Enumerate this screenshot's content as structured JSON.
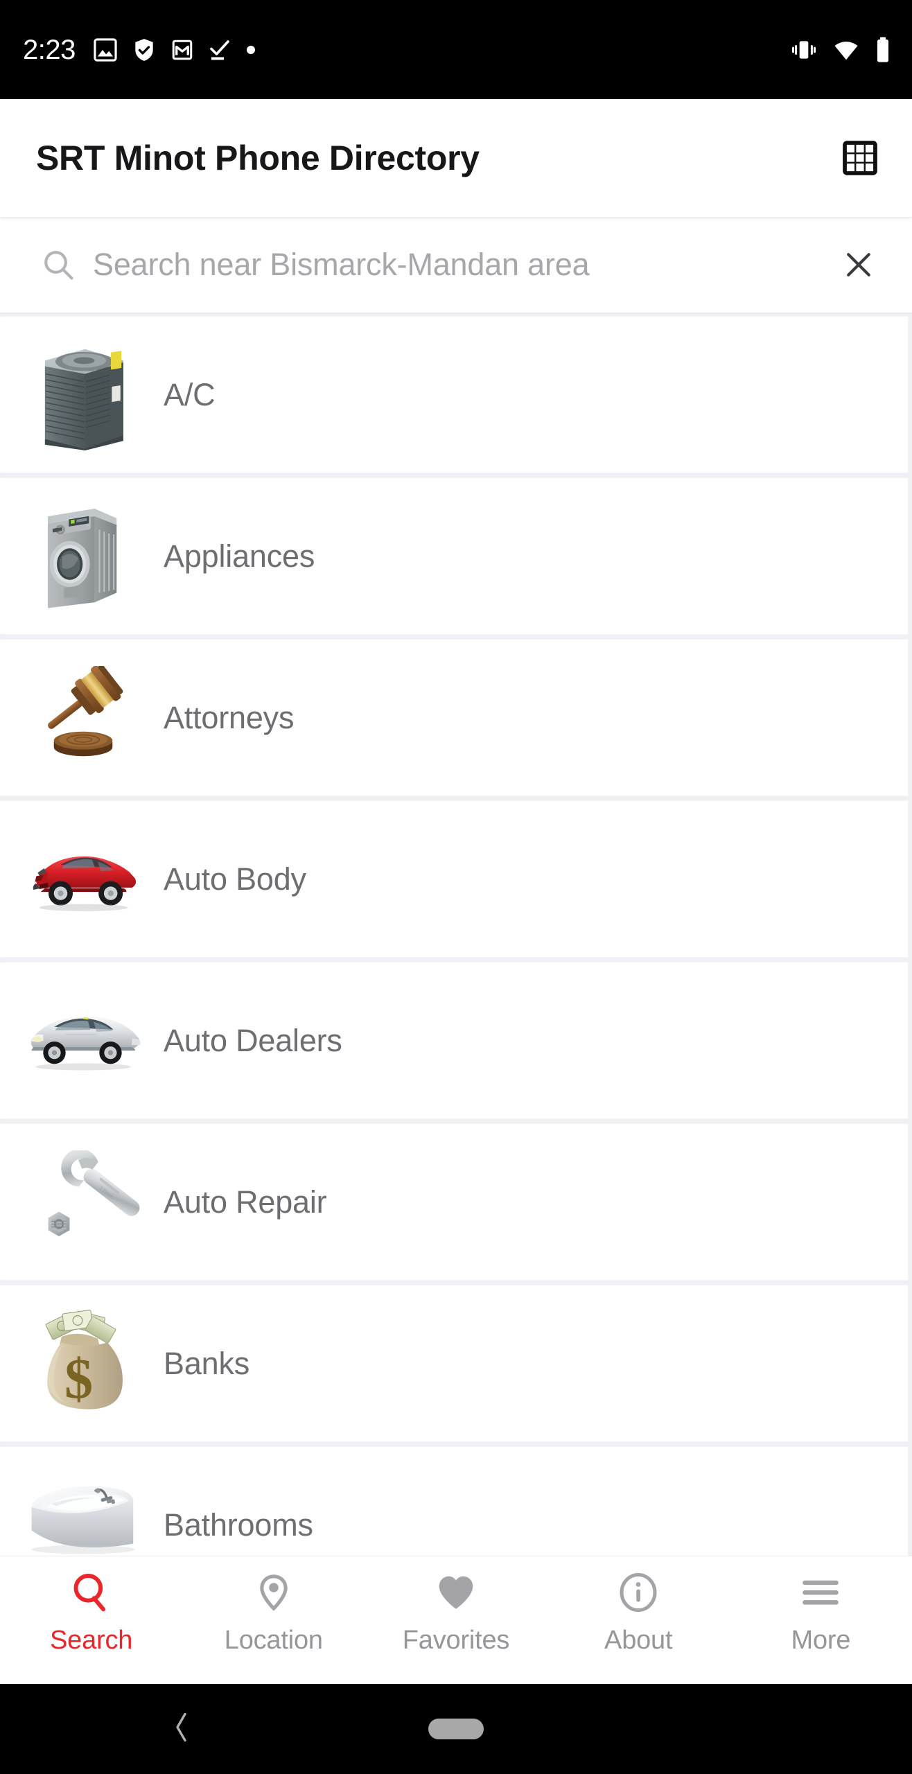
{
  "status_bar": {
    "time": "2:23",
    "left_icons": [
      "image-icon",
      "shield-check-icon",
      "gmail-icon",
      "task-check-icon",
      "dot-icon"
    ],
    "right_icons": [
      "vibrate-icon",
      "wifi-icon",
      "battery-icon"
    ]
  },
  "app_bar": {
    "title": "SRT Minot Phone Directory",
    "grid_icon": "grid-icon"
  },
  "search": {
    "placeholder": "Search near Bismarck-Mandan area",
    "value": "",
    "search_icon": "search-icon",
    "clear_icon": "close-icon"
  },
  "categories": [
    {
      "label": "A/C",
      "image": "air-conditioner-unit"
    },
    {
      "label": "Appliances",
      "image": "washing-machine"
    },
    {
      "label": "Attorneys",
      "image": "gavel"
    },
    {
      "label": "Auto Body",
      "image": "damaged-red-car"
    },
    {
      "label": "Auto Dealers",
      "image": "silver-sedan"
    },
    {
      "label": "Auto Repair",
      "image": "wrench-and-bolt"
    },
    {
      "label": "Banks",
      "image": "money-bag"
    },
    {
      "label": "Bathrooms",
      "image": "corner-bathtub"
    }
  ],
  "bottom_nav": {
    "items": [
      {
        "label": "Search",
        "icon": "search-icon",
        "active": true
      },
      {
        "label": "Location",
        "icon": "map-pin-icon",
        "active": false
      },
      {
        "label": "Favorites",
        "icon": "heart-icon",
        "active": false
      },
      {
        "label": "About",
        "icon": "info-icon",
        "active": false
      },
      {
        "label": "More",
        "icon": "hamburger-icon",
        "active": false
      }
    ]
  },
  "system_nav": {
    "back_icon": "chevron-left-icon",
    "home_icon": "home-pill-icon"
  },
  "colors": {
    "accent": "#e8262c",
    "page_background": "#eef0f4",
    "card_background": "#ffffff",
    "title_text": "#17171a",
    "body_text": "#6d6d72",
    "muted_text": "#95959a",
    "placeholder_text": "#a6a6ab",
    "status_bar_background": "#000000"
  }
}
